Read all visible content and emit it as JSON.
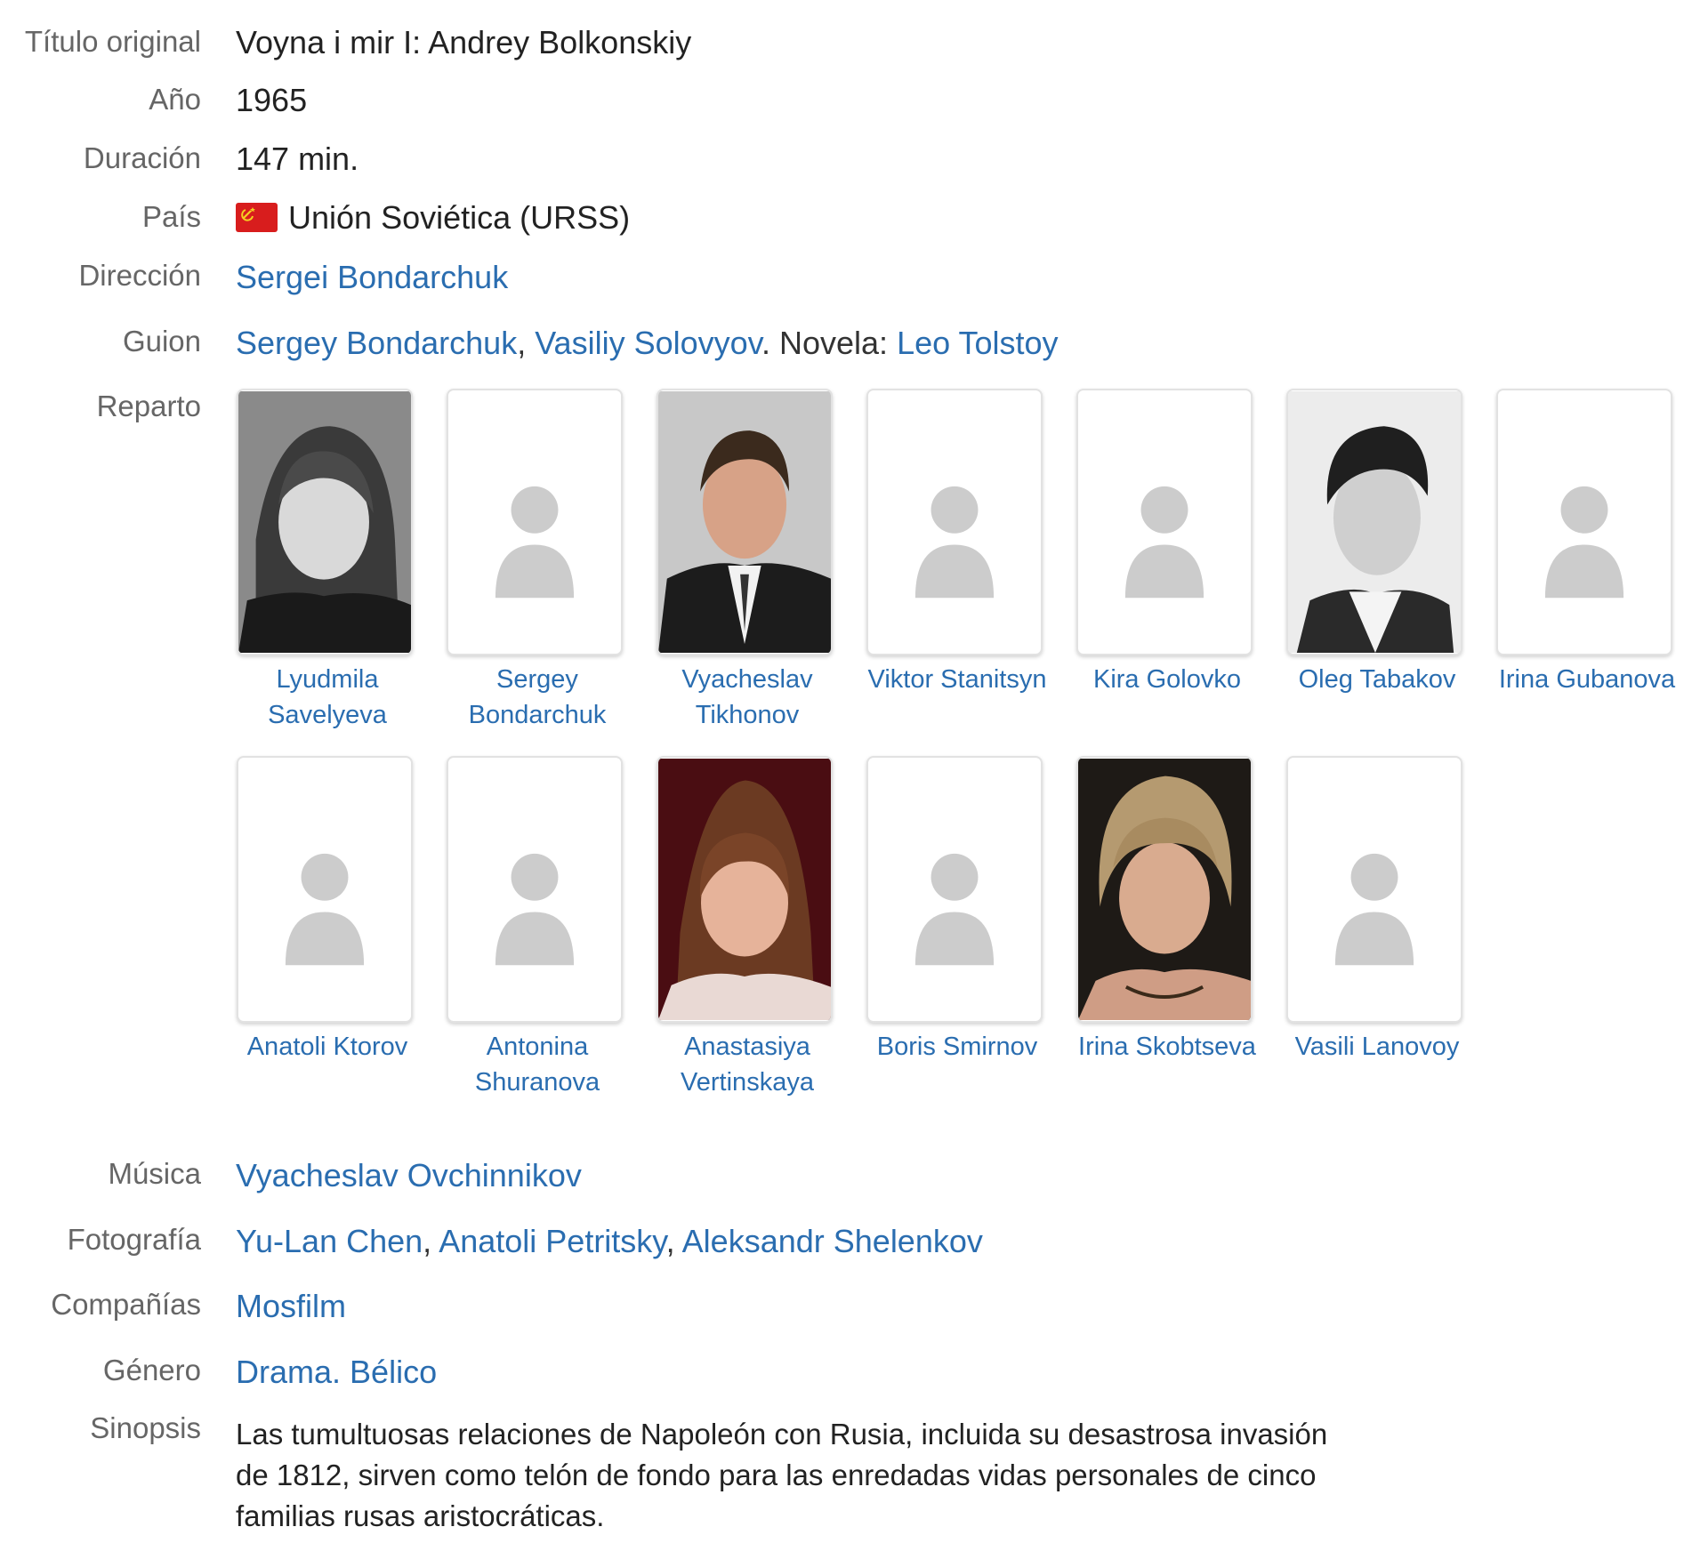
{
  "fields": {
    "titulo": {
      "label": "Título original",
      "value": "Voyna i mir I: Andrey Bolkonskiy"
    },
    "anio": {
      "label": "Año",
      "value": "1965"
    },
    "duracion": {
      "label": "Duración",
      "value": "147 min."
    },
    "pais": {
      "label": "País",
      "value": "Unión Soviética (URSS)",
      "flag_icon": "ussr-flag-icon"
    },
    "direccion": {
      "label": "Dirección",
      "people": [
        "Sergei Bondarchuk"
      ]
    },
    "guion": {
      "label": "Guion",
      "people": [
        "Sergey Bondarchuk",
        "Vasiliy Solovyov"
      ],
      "novel_prefix": "Novela:",
      "novel_author": "Leo Tolstoy"
    },
    "reparto": {
      "label": "Reparto"
    },
    "musica": {
      "label": "Música",
      "people": [
        "Vyacheslav Ovchinnikov"
      ]
    },
    "fotografia": {
      "label": "Fotografía",
      "people": [
        "Yu-Lan Chen",
        "Anatoli Petritsky",
        "Aleksandr Shelenkov"
      ]
    },
    "companias": {
      "label": "Compañías",
      "value": "Mosfilm"
    },
    "genero": {
      "label": "Género",
      "genres": [
        "Drama",
        "Bélico"
      ]
    },
    "sinopsis": {
      "label": "Sinopsis",
      "lines": [
        "Las tumultuosas relaciones de Napoleón con Rusia, incluida su desastrosa invasión",
        "de 1812, sirven como telón de fondo para las enredadas vidas personales de cinco",
        "familias rusas aristocráticas."
      ]
    }
  },
  "cast": [
    {
      "name_lines": [
        "Lyudmila",
        "Savelyeva"
      ],
      "photo": "portrait-bw-woman"
    },
    {
      "name_lines": [
        "Sergey",
        "Bondarchuk"
      ],
      "photo": "placeholder"
    },
    {
      "name_lines": [
        "Vyacheslav",
        "Tikhonov"
      ],
      "photo": "portrait-color-man"
    },
    {
      "name_lines": [
        "Viktor Stanitsyn"
      ],
      "photo": "placeholder"
    },
    {
      "name_lines": [
        "Kira Golovko"
      ],
      "photo": "placeholder"
    },
    {
      "name_lines": [
        "Oleg Tabakov"
      ],
      "photo": "portrait-bw-man"
    },
    {
      "name_lines": [
        "Irina Gubanova"
      ],
      "photo": "placeholder"
    },
    {
      "name_lines": [
        "Anatoli Ktorov"
      ],
      "photo": "placeholder"
    },
    {
      "name_lines": [
        "Antonina",
        "Shuranova"
      ],
      "photo": "placeholder"
    },
    {
      "name_lines": [
        "Anastasiya",
        "Vertinskaya"
      ],
      "photo": "portrait-color-woman-red"
    },
    {
      "name_lines": [
        "Boris Smirnov"
      ],
      "photo": "placeholder"
    },
    {
      "name_lines": [
        "Irina Skobtseva"
      ],
      "photo": "portrait-color-woman-dark"
    },
    {
      "name_lines": [
        "Vasili Lanovoy"
      ],
      "photo": "placeholder"
    }
  ],
  "colors": {
    "link": "#2a6db0",
    "label": "#666666",
    "flag": "#d81d1d",
    "placeholder_icon": "#cccccc"
  }
}
